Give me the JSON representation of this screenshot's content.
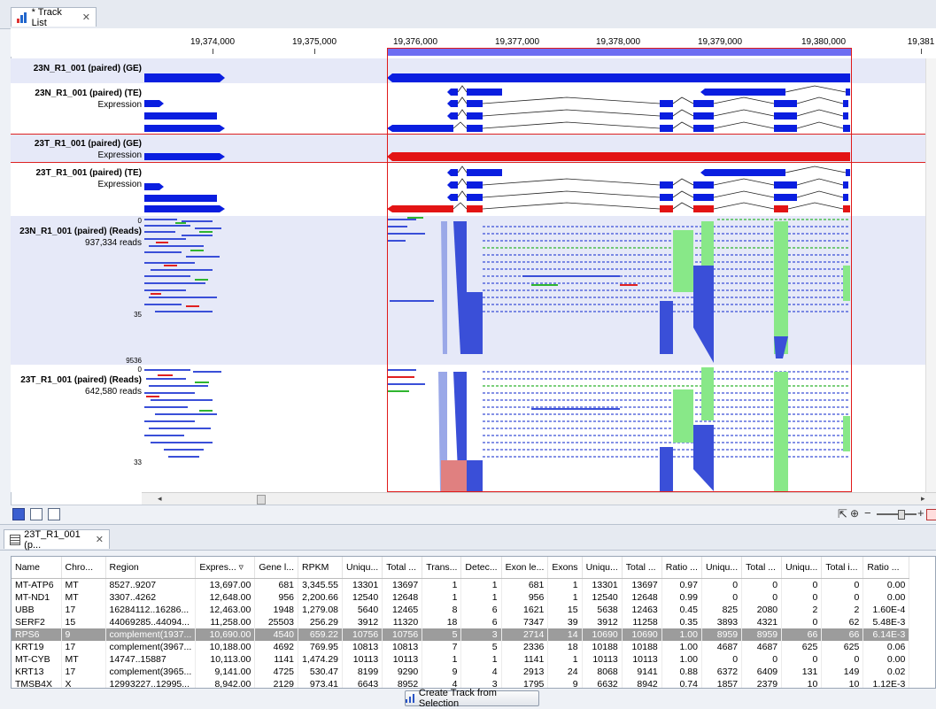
{
  "top_tab": {
    "title": "* Track List"
  },
  "ruler": {
    "labels": [
      "19,374,000",
      "19,375,000",
      "19,376,000",
      "19,377,000",
      "19,378,000",
      "19,379,000",
      "19,380,000",
      "19,381"
    ]
  },
  "tracks": {
    "t1": {
      "name": "23N_R1_001 (paired) (GE)"
    },
    "t2": {
      "name": "23N_R1_001 (paired) (TE)",
      "sub": "Expression"
    },
    "t3": {
      "name": "23T_R1_001 (paired) (GE)",
      "sub": "Expression"
    },
    "t4": {
      "name": "23T_R1_001 (paired) (TE)",
      "sub": "Expression"
    },
    "t5": {
      "name": "23N_R1_001 (paired) (Reads)",
      "sub": "937,334 reads",
      "scale_top": "0",
      "scale_mid": "35",
      "scale_bot": "9536"
    },
    "t6": {
      "name": "23T_R1_001 (paired) (Reads)",
      "sub": "642,580 reads",
      "scale_top": "0",
      "scale_mid": "33"
    }
  },
  "table_tab": {
    "title": "23T_R1_001 (p..."
  },
  "table": {
    "headers": [
      "Name",
      "Chro...",
      "Region",
      "Expres... ▿",
      "Gene l...",
      "RPKM",
      "Uniqu...",
      "Total ...",
      "Trans...",
      "Detec...",
      "Exon le...",
      "Exons",
      "Uniqu...",
      "Total ...",
      "Ratio ...",
      "Uniqu...",
      "Total ...",
      "Uniqu...",
      "Total i...",
      "Ratio ..."
    ],
    "rows": [
      [
        "MT-ATP6",
        "MT",
        "8527..9207",
        "13,697.00",
        "681",
        "3,345.55",
        "13301",
        "13697",
        "1",
        "1",
        "681",
        "1",
        "13301",
        "13697",
        "0.97",
        "0",
        "0",
        "0",
        "0",
        "0.00"
      ],
      [
        "MT-ND1",
        "MT",
        "3307..4262",
        "12,648.00",
        "956",
        "2,200.66",
        "12540",
        "12648",
        "1",
        "1",
        "956",
        "1",
        "12540",
        "12648",
        "0.99",
        "0",
        "0",
        "0",
        "0",
        "0.00"
      ],
      [
        "UBB",
        "17",
        "16284112..16286...",
        "12,463.00",
        "1948",
        "1,279.08",
        "5640",
        "12465",
        "8",
        "6",
        "1621",
        "15",
        "5638",
        "12463",
        "0.45",
        "825",
        "2080",
        "2",
        "2",
        "1.60E-4"
      ],
      [
        "SERF2",
        "15",
        "44069285..44094...",
        "11,258.00",
        "25503",
        "256.29",
        "3912",
        "11320",
        "18",
        "6",
        "7347",
        "39",
        "3912",
        "11258",
        "0.35",
        "3893",
        "4321",
        "0",
        "62",
        "5.48E-3"
      ],
      [
        "RPS6",
        "9",
        "complement(1937...",
        "10,690.00",
        "4540",
        "659.22",
        "10756",
        "10756",
        "5",
        "3",
        "2714",
        "14",
        "10690",
        "10690",
        "1.00",
        "8959",
        "8959",
        "66",
        "66",
        "6.14E-3"
      ],
      [
        "KRT19",
        "17",
        "complement(3967...",
        "10,188.00",
        "4692",
        "769.95",
        "10813",
        "10813",
        "7",
        "5",
        "2336",
        "18",
        "10188",
        "10188",
        "1.00",
        "4687",
        "4687",
        "625",
        "625",
        "0.06"
      ],
      [
        "MT-CYB",
        "MT",
        "14747..15887",
        "10,113.00",
        "1141",
        "1,474.29",
        "10113",
        "10113",
        "1",
        "1",
        "1141",
        "1",
        "10113",
        "10113",
        "1.00",
        "0",
        "0",
        "0",
        "0",
        "0.00"
      ],
      [
        "KRT13",
        "17",
        "complement(3965...",
        "9,141.00",
        "4725",
        "530.47",
        "8199",
        "9290",
        "9",
        "4",
        "2913",
        "24",
        "8068",
        "9141",
        "0.88",
        "6372",
        "6409",
        "131",
        "149",
        "0.02"
      ],
      [
        "TMSB4X",
        "X",
        "12993227..12995...",
        "8,942.00",
        "2129",
        "973.41",
        "6643",
        "8952",
        "4",
        "3",
        "1795",
        "9",
        "6632",
        "8942",
        "0.74",
        "1857",
        "2379",
        "10",
        "10",
        "1.12E-3"
      ]
    ]
  },
  "button": {
    "create_track": "Create Track from Selection"
  },
  "colors": {
    "blue": "#0a1ee0",
    "red": "#e31414",
    "selection": "#e01a1a",
    "green": "#88e888"
  }
}
